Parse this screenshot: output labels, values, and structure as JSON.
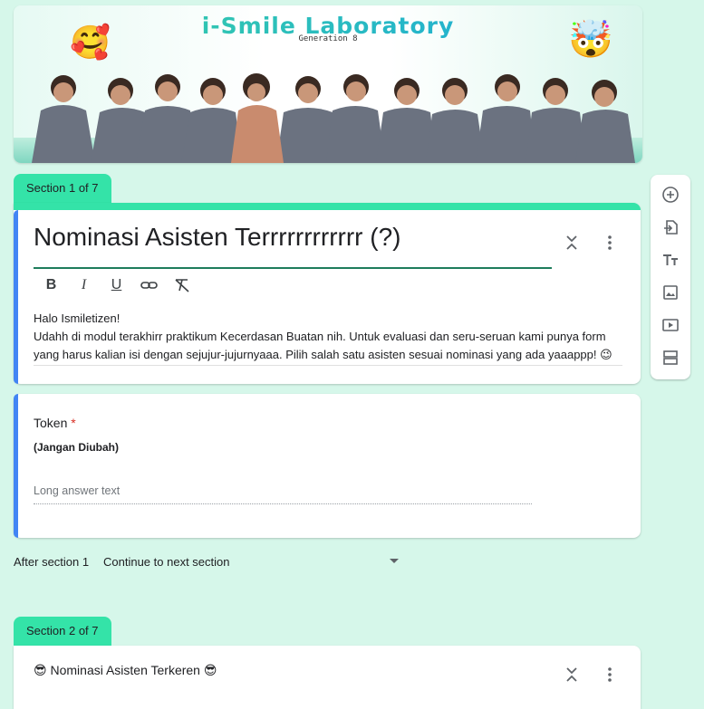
{
  "banner": {
    "title": "i-Smile Laboratory",
    "subtitle": "Generation 8",
    "emoji_left": "🥰",
    "emoji_right": "🤯"
  },
  "section1": {
    "tab_label": "Section 1 of 7",
    "form_title": "Nominasi Asisten Terrrrrrrrrrrr (?)",
    "description_lines": [
      "Halo Ismiletizen!",
      "Udahh di modul terakhirr praktikum Kecerdasan Buatan nih. Untuk evaluasi dan seru-seruan kami punya form",
      "yang harus kalian isi dengan sejujur-jujurnyaaa. Pilih salah satu asisten sesuai nominasi yang ada yaaappp! 😉"
    ],
    "format_toolbar": [
      "B",
      "I",
      "U",
      "link",
      "clear-format"
    ]
  },
  "question1": {
    "title": "Token",
    "required_mark": "*",
    "description": "(Jangan Diubah)",
    "answer_placeholder": "Long answer text"
  },
  "after_section": {
    "label": "After section 1",
    "selected": "Continue to next section"
  },
  "section2": {
    "tab_label": "Section 2 of 7",
    "title": "😎 Nominasi Asisten Terkeren 😎"
  },
  "colors": {
    "accent": "#34e3a8",
    "background": "#d6f7ea",
    "focus_bar": "#4285f4",
    "required": "#d93025"
  },
  "sidebar_tools": [
    "add-question-icon",
    "import-questions-icon",
    "add-title-icon",
    "add-image-icon",
    "add-video-icon",
    "add-section-icon"
  ]
}
